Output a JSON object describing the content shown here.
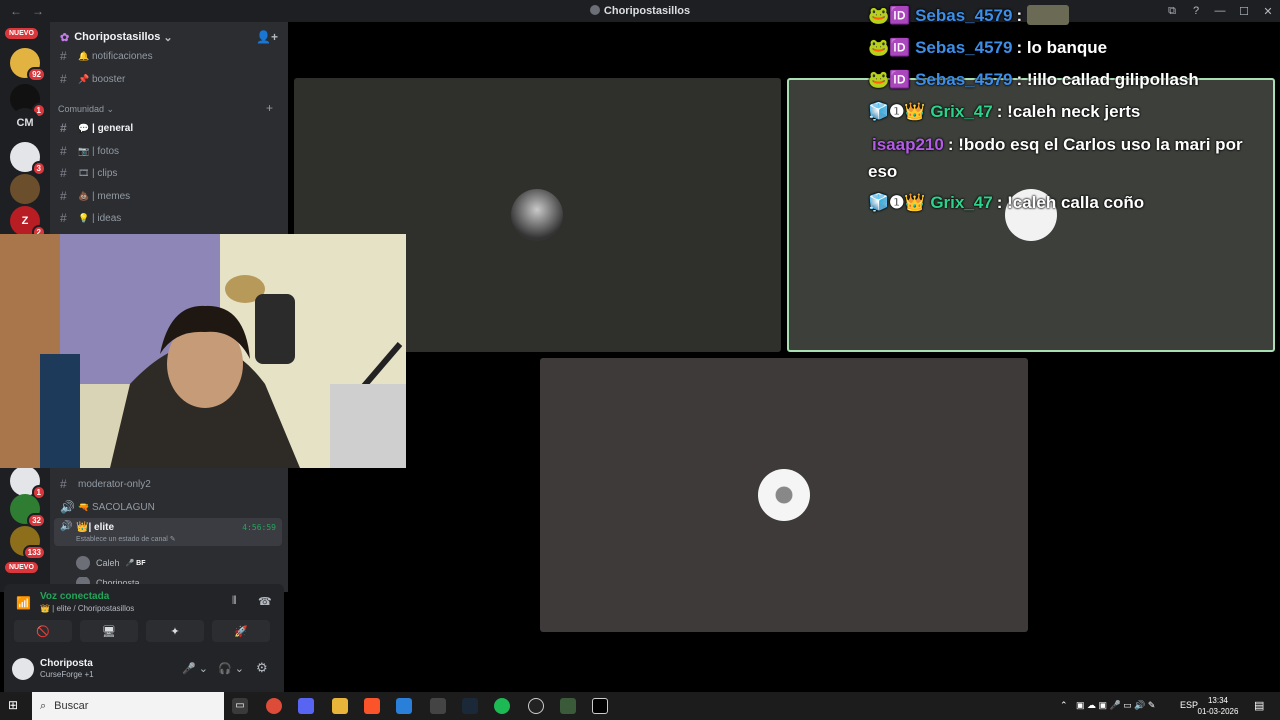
{
  "window": {
    "title": "Choripostasillos",
    "nav_back": "←",
    "nav_fwd": "→",
    "controls": [
      "⧉",
      "?",
      "—",
      "☐",
      "✕"
    ]
  },
  "rail": {
    "nuevo_top": "NUEVO",
    "nuevo_bottom": "NUEVO",
    "servers": [
      {
        "label": "",
        "badge": "92",
        "color": "#e3b341"
      },
      {
        "label": "",
        "badge": "1",
        "color": "#111111"
      },
      {
        "label": "CM",
        "badge": "",
        "color": "#1e1f22"
      },
      {
        "label": "",
        "badge": "3",
        "color": "#e3e5e8"
      },
      {
        "label": "",
        "badge": "",
        "color": "#6b4f2c"
      },
      {
        "label": "Z",
        "badge": "2",
        "color": "#b81d24"
      }
    ],
    "servers_low": [
      {
        "label": "",
        "badge": "1",
        "color": "#e3e5e8"
      },
      {
        "label": "",
        "badge": "32",
        "color": "#2f7d32"
      },
      {
        "label": "",
        "badge": "133",
        "color": "#8d6e1a"
      }
    ]
  },
  "server": {
    "name": "Choripostasillos",
    "chevron": "⌄",
    "invite_icon": "👤+"
  },
  "channels": [
    {
      "emoji": "🔔",
      "name": "notificaciones",
      "active": false
    },
    {
      "emoji": "📌",
      "name": "booster",
      "active": false
    }
  ],
  "category": {
    "name": "Comunidad",
    "chevron": "⌄",
    "plus": "+"
  },
  "community_channels": [
    {
      "emoji": "💬",
      "name": "| general",
      "active": true
    },
    {
      "emoji": "📷",
      "name": "| fotos",
      "active": false
    },
    {
      "emoji": "🎞",
      "name": "| clips",
      "active": false
    },
    {
      "emoji": "💩",
      "name": "| memes",
      "active": false
    },
    {
      "emoji": "💡",
      "name": "| ideas",
      "active": false
    }
  ],
  "lower_channels": [
    {
      "icon": "#",
      "emoji": "",
      "name": "moderator-only2"
    },
    {
      "icon": "🔊",
      "emoji": "🔫",
      "name": "SACOLAGUN"
    }
  ],
  "voice_channel": {
    "emoji": "👑",
    "name": "| elite",
    "timer": "4:56:59",
    "status": "Establece un estado de canal ✎"
  },
  "voice_members": [
    {
      "name": "Caleh",
      "tag": "🎤 BF"
    },
    {
      "name": "Choriposta",
      "tag": ""
    }
  ],
  "voice_panel": {
    "title": "Voz conectada",
    "subtitle": "👑 | elite / Choripostasillos",
    "buttons": [
      "🚫",
      "🖥",
      "✦",
      "🚀"
    ],
    "wave_icon": "⫴",
    "hangup_icon": "☎"
  },
  "user_panel": {
    "name": "Choriposta",
    "status": "CurseForge +1",
    "mic": "🎤 ⌄",
    "headphones": "🎧 ⌄",
    "settings": "⚙"
  },
  "tiles": [
    {
      "name": "tile-1",
      "bg": "#2f302c",
      "avatar": "#8a8a8a"
    },
    {
      "name": "tile-2",
      "bg": "#3c3f3a",
      "avatar": "#f2f2f2"
    },
    {
      "name": "tile-3",
      "bg": "#3e3a3a",
      "avatar": "#f5f5f5"
    }
  ],
  "chat": [
    {
      "badges": [
        "🐸",
        "🆔"
      ],
      "user": "Sebas_4579",
      "color": "#3c8ee8",
      "text": ": "
    },
    {
      "badges": [
        "🐸",
        "🆔"
      ],
      "user": "Sebas_4579",
      "color": "#3c8ee8",
      "text": ": lo banque"
    },
    {
      "badges": [
        "🐸",
        "🆔"
      ],
      "user": "Sebas_4579",
      "color": "#3c8ee8",
      "text": ": !illo callad gilipollash"
    },
    {
      "badges": [
        "🧊",
        "❶",
        "👑"
      ],
      "user": "Grix_47",
      "color": "#2bd48a",
      "text": ": !caleh neck jerts"
    },
    {
      "badges": [],
      "user": "isaap210",
      "color": "#b45ce8",
      "text": ": !bodo esq el Carlos uso la mari por"
    },
    {
      "badges": [],
      "user": "",
      "color": "#ffffff",
      "text": "eso"
    },
    {
      "badges": [
        "🧊",
        "❶",
        "👑"
      ],
      "user": "Grix_47",
      "color": "#2bd48a",
      "text": ": !caleh calla coño"
    }
  ],
  "taskbar": {
    "search_placeholder": "Buscar",
    "lang": "ESP",
    "time": "13:34",
    "date": "01-03-2026",
    "apps": [
      "Task View",
      "Chrome",
      "Discord",
      "Files",
      "Brave",
      "Store",
      "App",
      "Steam",
      "Spotify",
      "Obs",
      "Game",
      "CapCut"
    ]
  }
}
